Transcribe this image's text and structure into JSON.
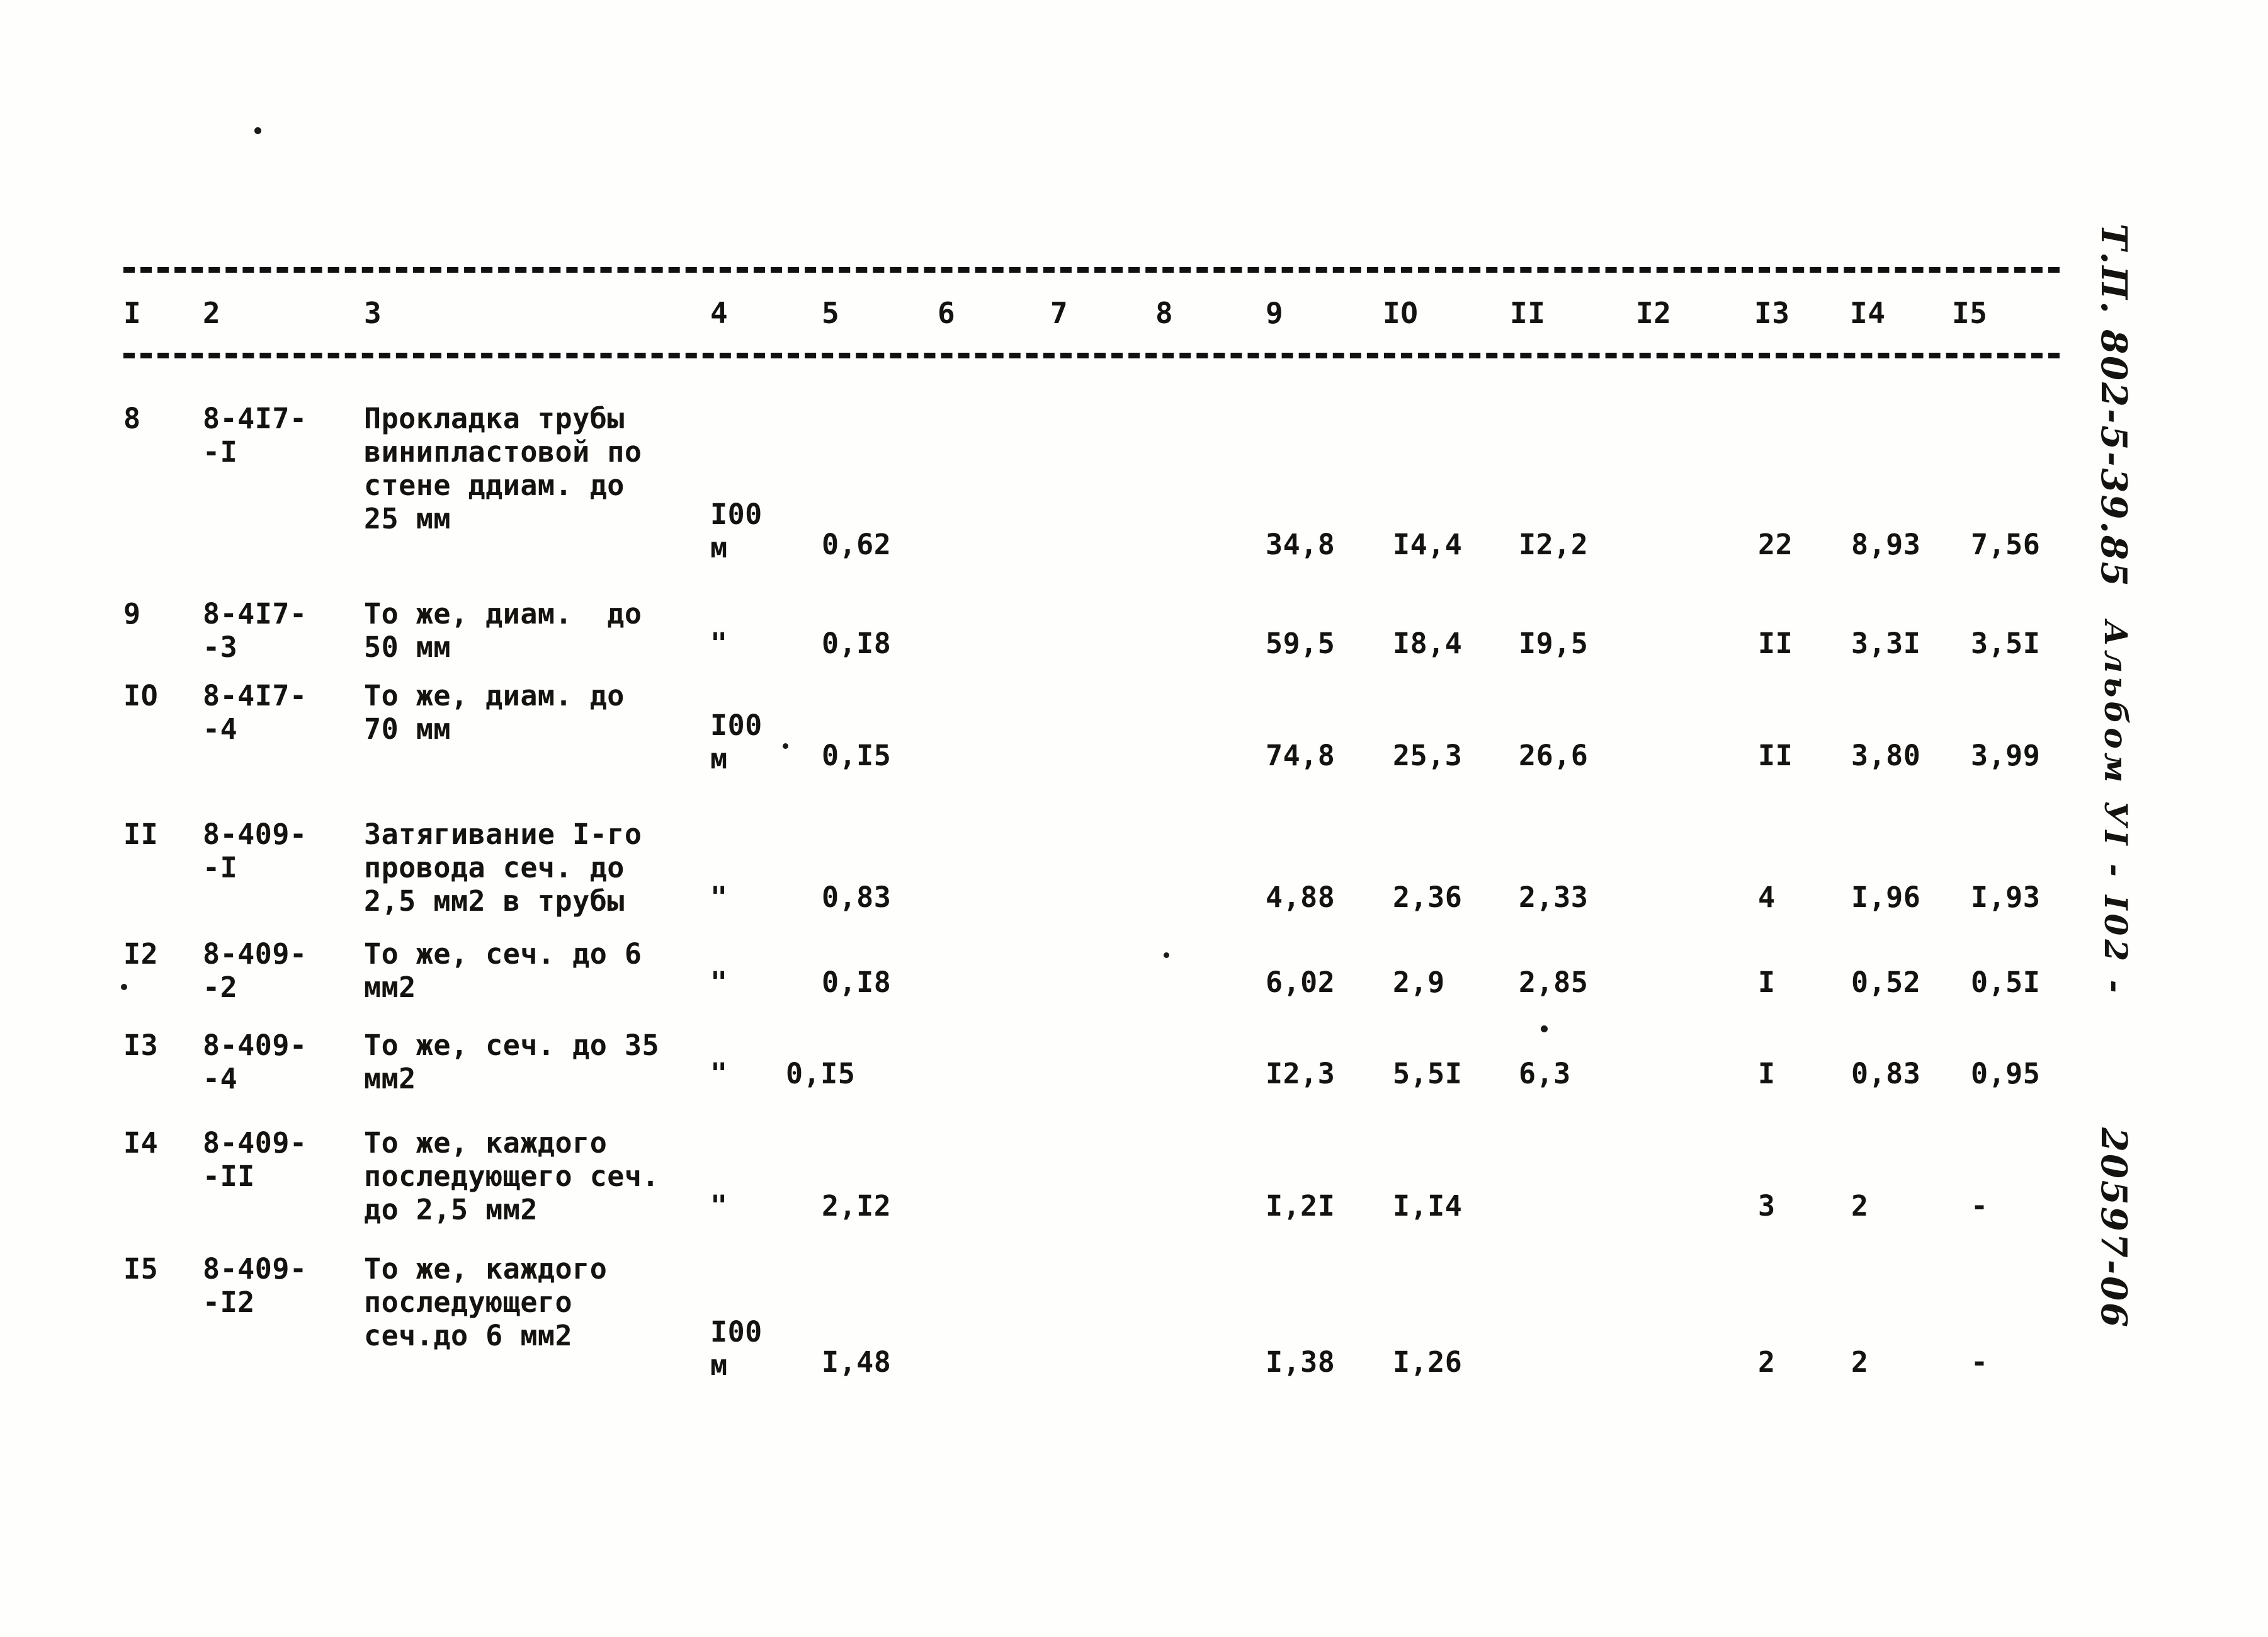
{
  "document": {
    "margin_notes": {
      "type_project": "Т.П. 802-5-39.85",
      "album": "Альбом УI  -  I02  -",
      "doc_number": "20597-06"
    }
  },
  "table": {
    "column_headers": [
      "I",
      "2",
      "3",
      "4",
      "5",
      "6",
      "7",
      "8",
      "9",
      "IO",
      "II",
      "I2",
      "I3",
      "I4",
      "I5"
    ],
    "rows": [
      {
        "num": "8",
        "code_line1": "8-4I7-",
        "code_line2": "-I",
        "name_lines": [
          "Прокладка трубы",
          "винипластовой по",
          "стене ддиам. до",
          "25 мм"
        ],
        "unit_lines": [
          "I00",
          "м"
        ],
        "c5": "0,62",
        "c9": "34,8",
        "c10": "I4,4",
        "c11": "I2,2",
        "c13": "22",
        "c14": "8,93",
        "c15": "7,56"
      },
      {
        "num": "9",
        "code_line1": "8-4I7-",
        "code_line2": "-3",
        "name_lines": [
          "То же, диам.  до",
          "50 мм"
        ],
        "unit_lines": [
          "\"",
          ""
        ],
        "c5": "0,I8",
        "c9": "59,5",
        "c10": "I8,4",
        "c11": "I9,5",
        "c13": "II",
        "c14": "3,3I",
        "c15": "3,5I"
      },
      {
        "num": "IO",
        "code_line1": "8-4I7-",
        "code_line2": "-4",
        "name_lines": [
          "То же, диам. до",
          "70 мм"
        ],
        "unit_lines": [
          "I00",
          "м"
        ],
        "c5": "0,I5",
        "c9": "74,8",
        "c10": "25,3",
        "c11": "26,6",
        "c13": "II",
        "c14": "3,80",
        "c15": "3,99"
      },
      {
        "num": "II",
        "code_line1": "8-409-",
        "code_line2": "-I",
        "name_lines": [
          "Затягивание I-го",
          "провода сеч. до",
          "2,5 мм2 в трубы"
        ],
        "unit_lines": [
          "\"",
          ""
        ],
        "c5": "0,83",
        "c9": "4,88",
        "c10": "2,36",
        "c11": "2,33",
        "c13": "4",
        "c14": "I,96",
        "c15": "I,93"
      },
      {
        "num": "I2",
        "code_line1": "8-409-",
        "code_line2": "-2",
        "name_lines": [
          "То же, сеч. до 6",
          "мм2"
        ],
        "unit_lines": [
          "\"",
          ""
        ],
        "c5": "0,I8",
        "c9": "6,02",
        "c10": "2,9",
        "c11": "2,85",
        "c13": "I",
        "c14": "0,52",
        "c15": "0,5I"
      },
      {
        "num": "I3",
        "code_line1": "8-409-",
        "code_line2": "-4",
        "name_lines": [
          "То же, сеч. до 35",
          "мм2"
        ],
        "unit_lines": [
          "\"",
          ""
        ],
        "c5": "0,I5",
        "c9": "I2,3",
        "c10": "5,5I",
        "c11": "6,3",
        "c13": "I",
        "c14": "0,83",
        "c15": "0,95"
      },
      {
        "num": "I4",
        "code_line1": "8-409-",
        "code_line2": "-II",
        "name_lines": [
          "То же, каждого",
          "последующего сеч.",
          "до 2,5 мм2"
        ],
        "unit_lines": [
          "\"",
          ""
        ],
        "c5": "2,I2",
        "c9": "I,2I",
        "c10": "I,I4",
        "c11": "",
        "c13": "3",
        "c14": "2",
        "c15": "-"
      },
      {
        "num": "I5",
        "code_line1": "8-409-",
        "code_line2": "-I2",
        "name_lines": [
          "То же, каждого",
          "последующего",
          "сеч.до 6 мм2"
        ],
        "unit_lines": [
          "I00",
          "м"
        ],
        "c5": "I,48",
        "c9": "I,38",
        "c10": "I,26",
        "c11": "",
        "c13": "2",
        "c14": "2",
        "c15": "-"
      }
    ]
  }
}
